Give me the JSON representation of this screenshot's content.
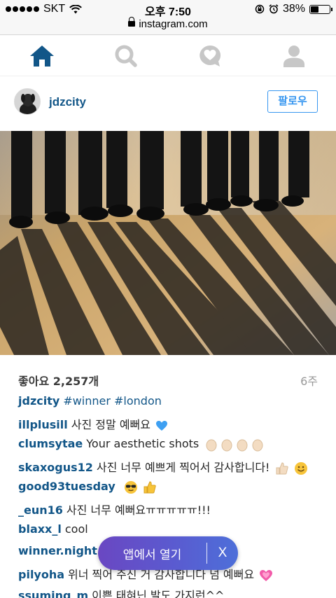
{
  "status_bar": {
    "carrier": "SKT",
    "time": "오후 7:50",
    "battery": "38%",
    "battery_level": 0.38
  },
  "browser": {
    "url": "instagram.com"
  },
  "nav": {
    "items": [
      {
        "name": "home-icon",
        "active": true
      },
      {
        "name": "search-icon",
        "active": false
      },
      {
        "name": "activity-heart-icon",
        "active": false
      },
      {
        "name": "profile-icon",
        "active": false
      }
    ]
  },
  "post": {
    "username": "jdzcity",
    "follow_label": "팔로우",
    "likes": "좋아요 2,257개",
    "time_ago": "6주",
    "caption": {
      "user": "jdzcity",
      "tags": "#winner #london"
    },
    "comments": [
      {
        "user": "illplusill",
        "text": "사진 정말 예뻐요"
      },
      {
        "user": "clumsytae",
        "text": "Your aesthetic shots"
      },
      {
        "user": "skaxogus12",
        "text": "사진 너무 예쁘게 찍어서 감사합니다!"
      },
      {
        "user": "good93tuesday",
        "text": ""
      },
      {
        "user": "_eun16",
        "text": "사진 너무 예뻐요ㅠㅠㅠㅠㅠ!!!"
      },
      {
        "user": "blaxx_l",
        "text": "cool"
      },
      {
        "user": "winner.night",
        "text": "P"
      },
      {
        "user": "pilyoha",
        "text": "위너 찍어 주신 거 감사합니다 넘 예뻐요"
      },
      {
        "user": "ssuming_m",
        "text": "이쁜 태혀닌 발도 가지런^^"
      }
    ]
  },
  "open_app": {
    "label": "앱에서 열기",
    "close": "X"
  },
  "colors": {
    "link": "#125688",
    "follow": "#3897f0",
    "pill_start": "#6a47c2",
    "pill_end": "#4d6fd9"
  }
}
